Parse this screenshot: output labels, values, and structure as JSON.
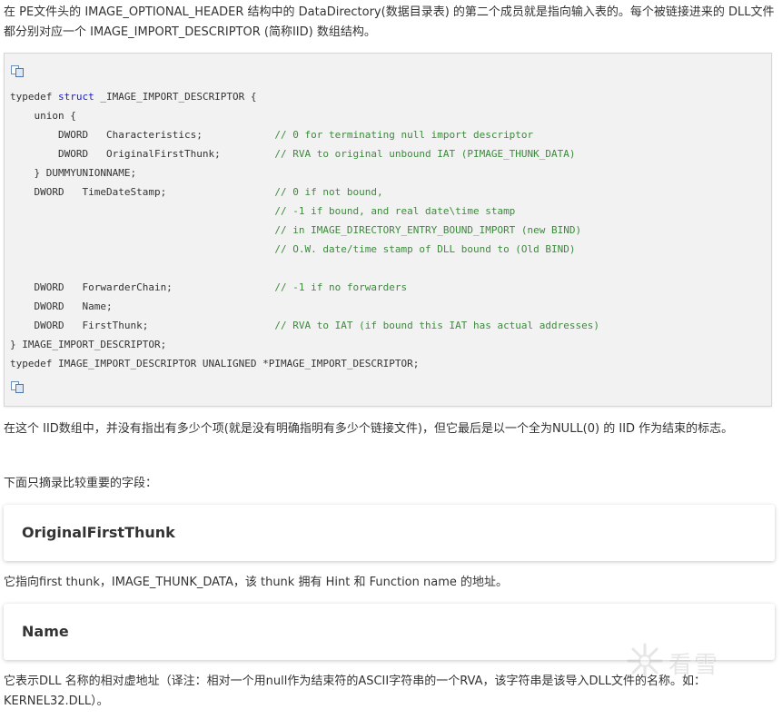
{
  "paragraphs": {
    "intro": "在 PE文件头的 IMAGE_OPTIONAL_HEADER 结构中的 DataDirectory(数据目录表) 的第二个成员就是指向输入表的。每个被链接进来的 DLL文件都分别对应一个 IMAGE_IMPORT_DESCRIPTOR (简称IID) 数组结构。",
    "iid_end": "在这个 IID数组中，并没有指出有多少个项(就是没有明确指明有多少个链接文件)，但它最后是以一个全为NULL(0) 的 IID 作为结束的标志。",
    "fields_intro": "下面只摘录比较重要的字段：",
    "first_thunk_desc": "它指向first thunk，IMAGE_THUNK_DATA，该 thunk 拥有 Hint 和 Function name 的地址。",
    "name_desc": "它表示DLL 名称的相对虚地址（译注：相对一个用null作为结束符的ASCII字符串的一个RVA，该字符串是该导入DLL文件的名称。如：KERNEL32.DLL）。"
  },
  "code": {
    "copy_icon": "copy-icon",
    "lines": [
      {
        "pre": "typedef ",
        "kw": "struct",
        "post": " _IMAGE_IMPORT_DESCRIPTOR {",
        "comment": ""
      },
      {
        "pre": "    union {",
        "kw": "",
        "post": "",
        "comment": ""
      },
      {
        "pre": "        DWORD   Characteristics;            ",
        "kw": "",
        "post": "",
        "comment": "// 0 for terminating null import descriptor"
      },
      {
        "pre": "        DWORD   OriginalFirstThunk;         ",
        "kw": "",
        "post": "",
        "comment": "// RVA to original unbound IAT (PIMAGE_THUNK_DATA)"
      },
      {
        "pre": "    } DUMMYUNIONNAME;",
        "kw": "",
        "post": "",
        "comment": ""
      },
      {
        "pre": "    DWORD   TimeDateStamp;                  ",
        "kw": "",
        "post": "",
        "comment": "// 0 if not bound,"
      },
      {
        "pre": "                                            ",
        "kw": "",
        "post": "",
        "comment": "// -1 if bound, and real date\\time stamp"
      },
      {
        "pre": "                                            ",
        "kw": "",
        "post": "",
        "comment": "// in IMAGE_DIRECTORY_ENTRY_BOUND_IMPORT (new BIND)"
      },
      {
        "pre": "                                            ",
        "kw": "",
        "post": "",
        "comment": "// O.W. date/time stamp of DLL bound to (Old BIND)"
      },
      {
        "pre": "",
        "kw": "",
        "post": "",
        "comment": ""
      },
      {
        "pre": "    DWORD   ForwarderChain;                 ",
        "kw": "",
        "post": "",
        "comment": "// -1 if no forwarders"
      },
      {
        "pre": "    DWORD   Name;",
        "kw": "",
        "post": "",
        "comment": ""
      },
      {
        "pre": "    DWORD   FirstThunk;                     ",
        "kw": "",
        "post": "",
        "comment": "// RVA to IAT (if bound this IAT has actual addresses)"
      },
      {
        "pre": "} IMAGE_IMPORT_DESCRIPTOR;",
        "kw": "",
        "post": "",
        "comment": ""
      },
      {
        "pre": "typedef IMAGE_IMPORT_DESCRIPTOR UNALIGNED *PIMAGE_IMPORT_DESCRIPTOR;",
        "kw": "",
        "post": "",
        "comment": ""
      }
    ]
  },
  "headings": {
    "original_first_thunk": "OriginalFirstThunk",
    "name": "Name"
  },
  "watermark": {
    "icon": "kanxue-logo-icon",
    "text": "看雪"
  },
  "colors": {
    "keyword": "#1a1acc",
    "comment": "#3d8a3d",
    "code_bg": "#f2f2f2",
    "text": "#333333"
  }
}
